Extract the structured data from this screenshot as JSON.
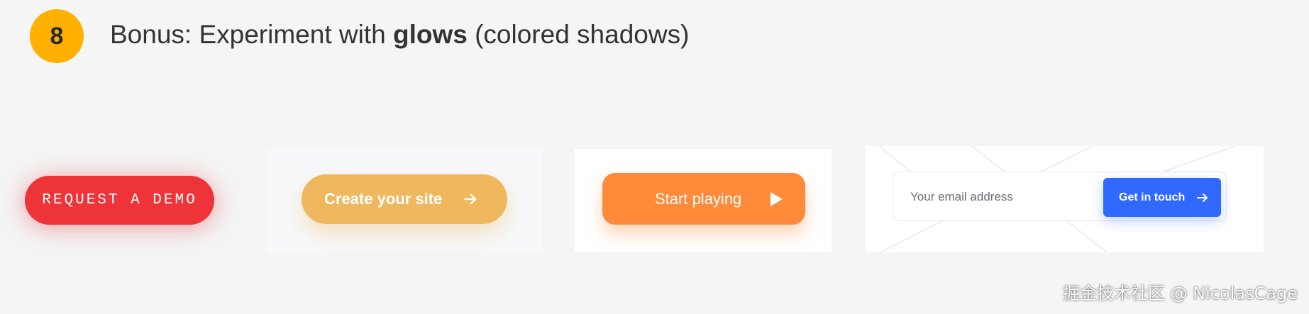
{
  "header": {
    "step_number": "8",
    "title_prefix": "Bonus: Experiment with ",
    "title_bold": "glows",
    "title_suffix": " (colored shadows)"
  },
  "buttons": {
    "request_demo": "REQUEST A DEMO",
    "create_site": "Create your site",
    "start_playing": "Start playing",
    "get_in_touch": "Get in touch"
  },
  "email": {
    "placeholder": "Your email address"
  },
  "watermark": "掘金技术社区 @ NicolasCage",
  "colors": {
    "badge": "#ffb000",
    "red": "#ee3439",
    "yellow": "#efb75e",
    "orange": "#ff8a3a",
    "blue": "#2f69ff"
  },
  "icons": {
    "create_site": "arrow-right-icon",
    "start_playing": "play-icon",
    "get_in_touch": "arrow-right-icon"
  }
}
